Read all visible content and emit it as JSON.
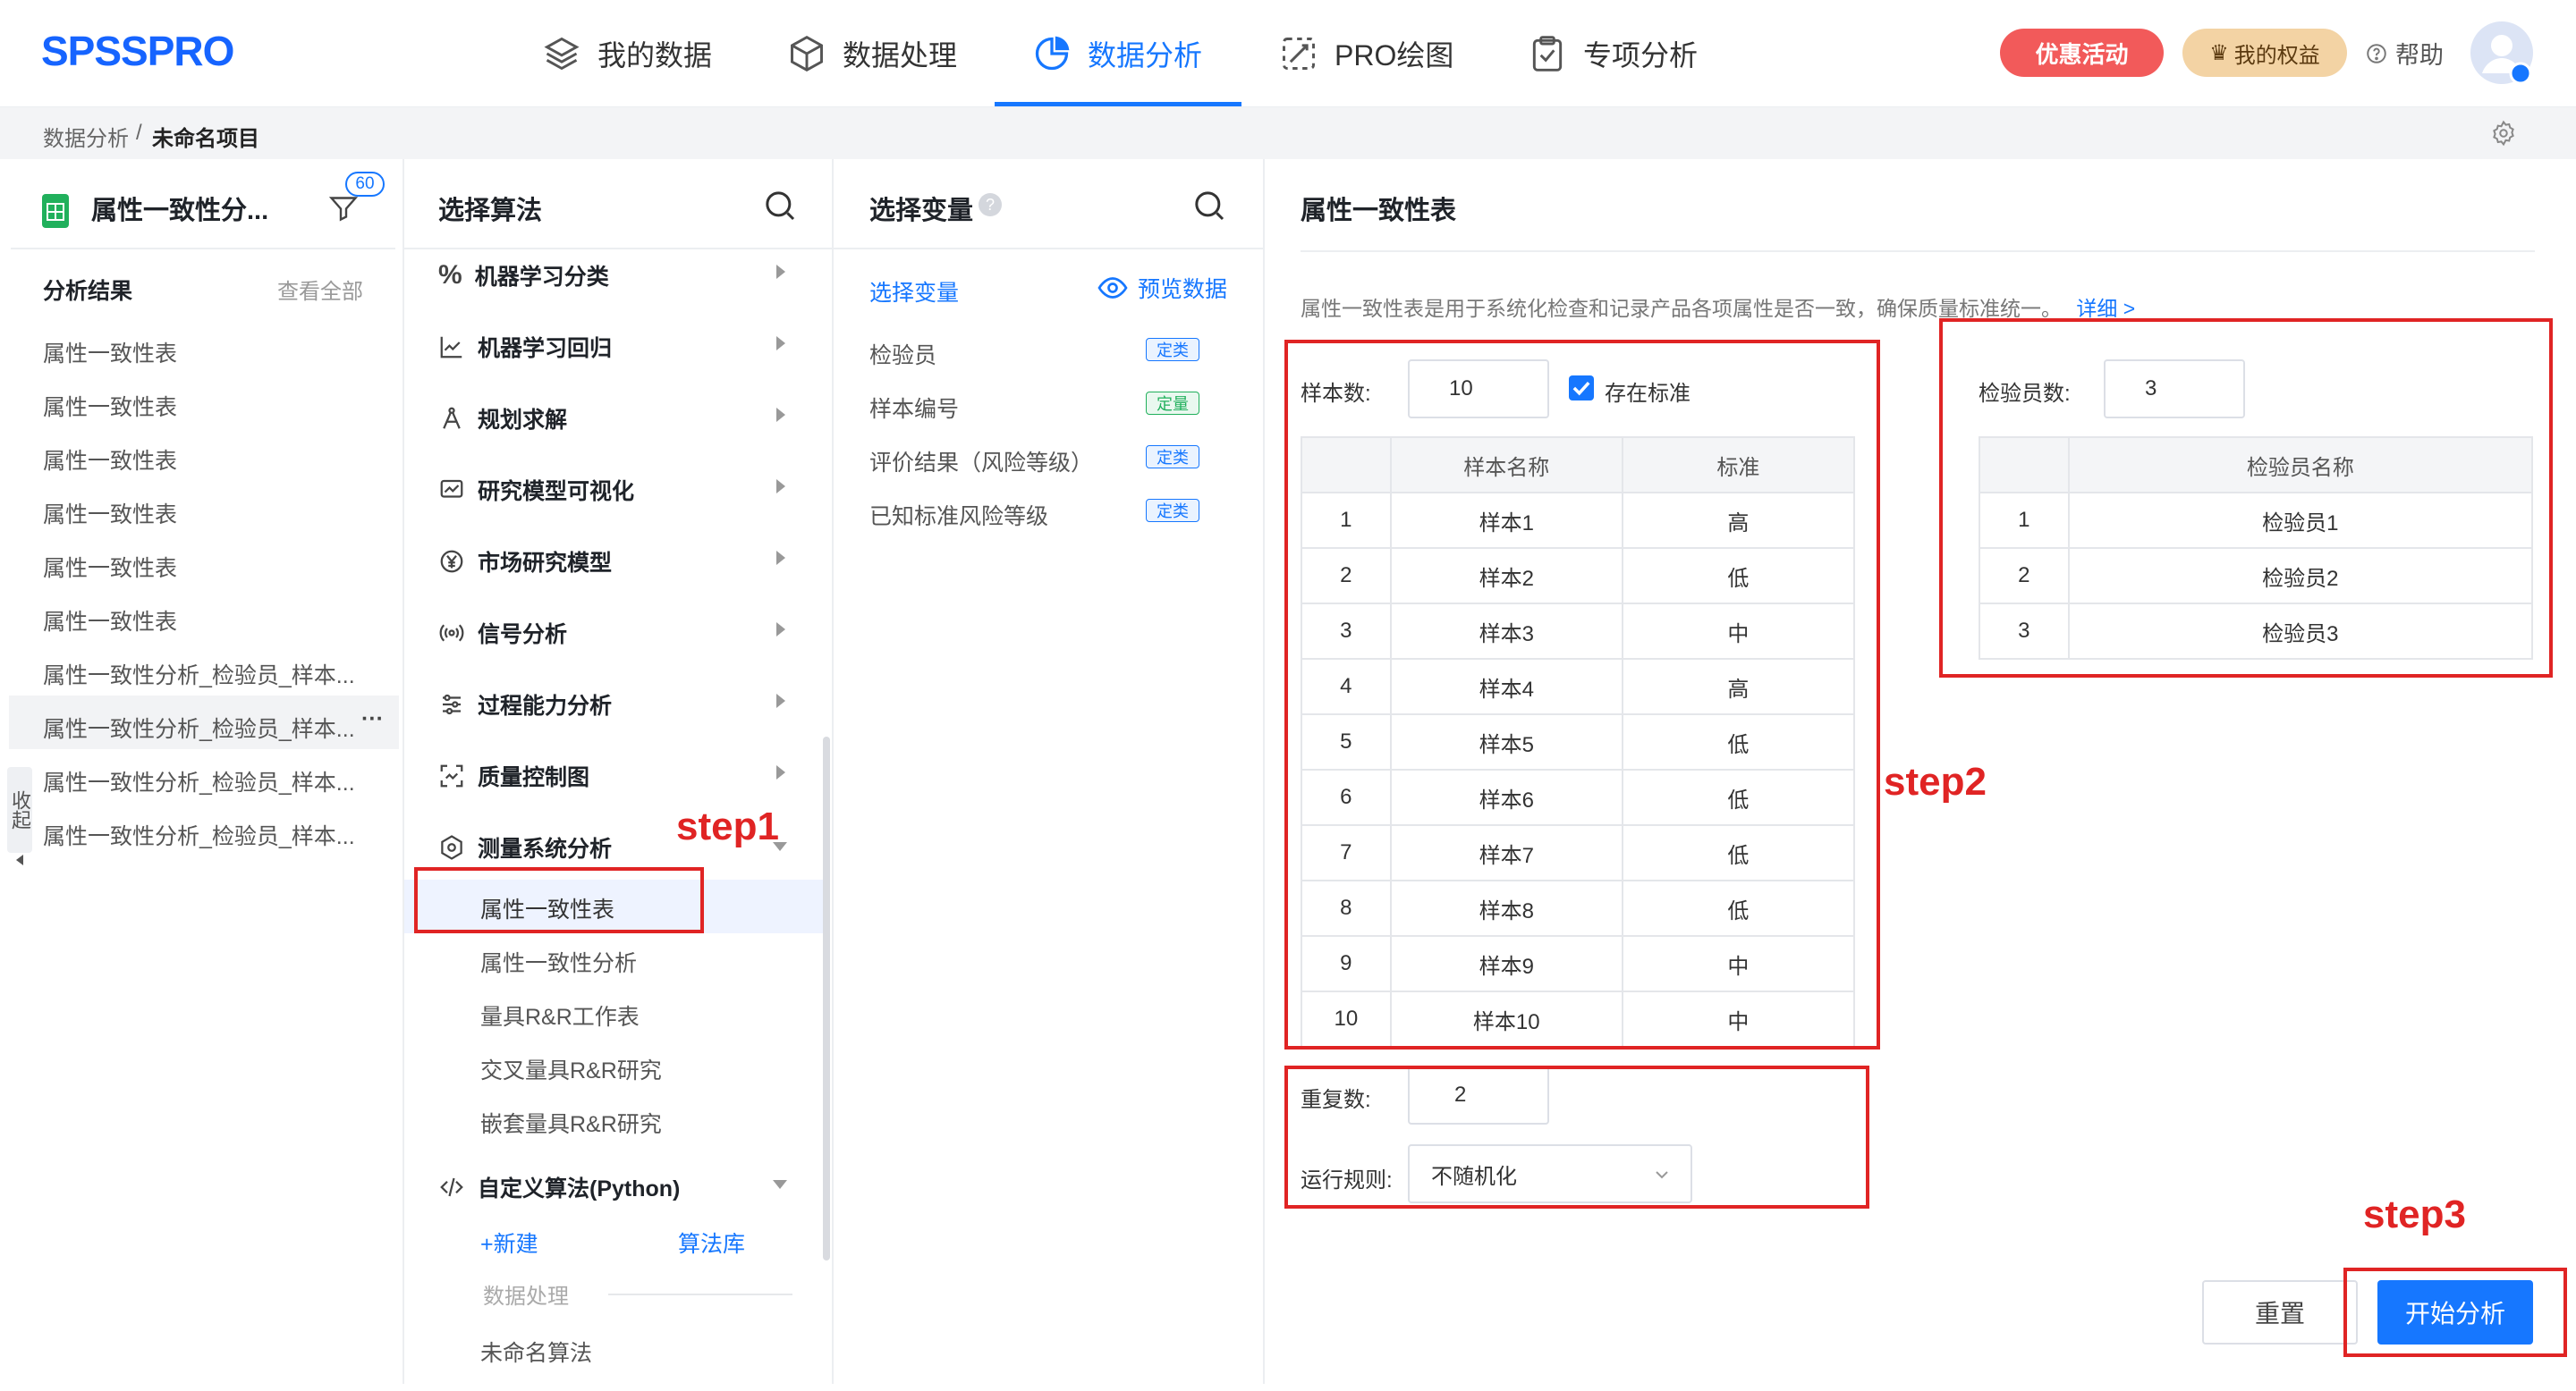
{
  "app": {
    "logo": "SPSSPRO"
  },
  "nav": [
    {
      "label": "我的数据",
      "icon": "layers-icon"
    },
    {
      "label": "数据处理",
      "icon": "cube-icon"
    },
    {
      "label": "数据分析",
      "icon": "pie-chart-icon",
      "active": true
    },
    {
      "label": "PRO绘图",
      "icon": "brush-icon"
    },
    {
      "label": "专项分析",
      "icon": "clipboard-check-icon"
    }
  ],
  "header": {
    "promo": "优惠活动",
    "rights": "我的权益",
    "help": "帮助"
  },
  "breadcrumb": {
    "root": "数据分析",
    "sep": "/",
    "current": "未命名项目"
  },
  "left_panel": {
    "title": "属性一致性分...",
    "filter_badge": "60",
    "results_title": "分析结果",
    "view_all": "查看全部",
    "collapse_label": "收起",
    "more": "···",
    "items": [
      "属性一致性表",
      "属性一致性表",
      "属性一致性表",
      "属性一致性表",
      "属性一致性表",
      "属性一致性表",
      "属性一致性分析_检验员_样本...",
      "属性一致性分析_检验员_样本...",
      "属性一致性分析_检验员_样本...",
      "属性一致性分析_检验员_样本..."
    ]
  },
  "algo_panel": {
    "title": "选择算法",
    "categories": [
      "机器学习分类",
      "机器学习回归",
      "规划求解",
      "研究模型可视化",
      "市场研究模型",
      "信号分析",
      "过程能力分析",
      "质量控制图",
      "测量系统分析"
    ],
    "msa_items": [
      "属性一致性表",
      "属性一致性分析",
      "量具R&R工作表",
      "交叉量具R&R研究",
      "嵌套量具R&R研究"
    ],
    "custom_title": "自定义算法(Python)",
    "new_label": "+新建",
    "library_label": "算法库",
    "data_processing_label": "数据处理",
    "unnamed_algo": "未命名算法"
  },
  "var_panel": {
    "title": "选择变量",
    "sub_title": "选择变量",
    "preview": "预览数据",
    "variables": [
      {
        "name": "检验员",
        "tag": "定类"
      },
      {
        "name": "样本编号",
        "tag": "定量"
      },
      {
        "name": "评价结果（风险等级）",
        "tag": "定类"
      },
      {
        "name": "已知标准风险等级",
        "tag": "定类"
      }
    ]
  },
  "main": {
    "title": "属性一致性表",
    "description": "属性一致性表是用于系统化检查和记录产品各项属性是否一致，确保质量标准统一。",
    "detail_link": "详细 >",
    "sample_count_label": "样本数:",
    "sample_count": "10",
    "has_standard_label": "存在标准",
    "samples_table": {
      "headers": [
        "",
        "样本名称",
        "标准"
      ],
      "rows": [
        [
          "1",
          "样本1",
          "高"
        ],
        [
          "2",
          "样本2",
          "低"
        ],
        [
          "3",
          "样本3",
          "中"
        ],
        [
          "4",
          "样本4",
          "高"
        ],
        [
          "5",
          "样本5",
          "低"
        ],
        [
          "6",
          "样本6",
          "低"
        ],
        [
          "7",
          "样本7",
          "低"
        ],
        [
          "8",
          "样本8",
          "低"
        ],
        [
          "9",
          "样本9",
          "中"
        ],
        [
          "10",
          "样本10",
          "中"
        ]
      ]
    },
    "inspector_count_label": "检验员数:",
    "inspector_count": "3",
    "inspectors_table": {
      "headers": [
        "",
        "检验员名称"
      ],
      "rows": [
        [
          "1",
          "检验员1"
        ],
        [
          "2",
          "检验员2"
        ],
        [
          "3",
          "检验员3"
        ]
      ]
    },
    "repeat_label": "重复数:",
    "repeat_value": "2",
    "rule_label": "运行规则:",
    "rule_value": "不随机化",
    "reset_label": "重置",
    "start_label": "开始分析"
  },
  "annotations": {
    "step1": "step1",
    "step2": "step2",
    "step3": "step3"
  },
  "colors": {
    "primary": "#1677ff",
    "annotation": "#e02424",
    "promo": "#f25a5a",
    "rights": "#f3d3a4"
  }
}
